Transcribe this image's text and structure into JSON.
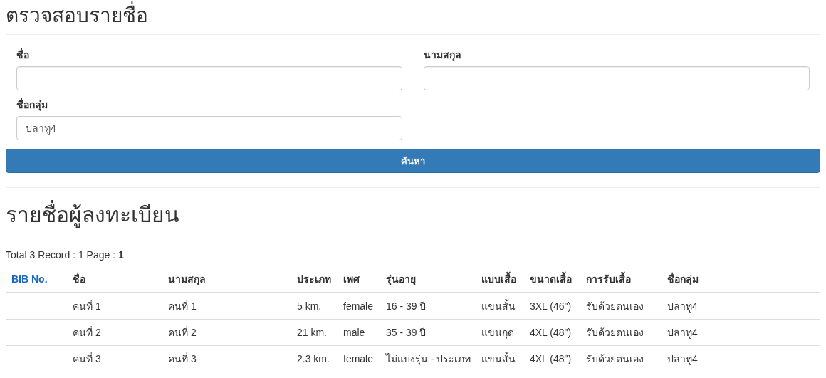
{
  "title": "ตรวจสอบรายชื่อ",
  "search_form": {
    "fields": [
      {
        "label": "ชื่อ"
      },
      {
        "label": "นามสกุล"
      },
      {
        "label": "ชื่อกลุ่ม",
        "value": "ปลาทู4"
      }
    ],
    "submit_button": "ค้นหา"
  },
  "results_title": "รายชื่อผู้ลงทะเบียน",
  "summary": "Total 3 Record : 1 Page : **1**",
  "table": {
    "columns": [
      {
        "label": "BIB No.",
        "kind": "link"
      },
      {
        "label": "ชื่อ",
        "kind": "text"
      },
      {
        "label": "นามสกุล",
        "kind": "text"
      },
      {
        "label": "ประเภท",
        "kind": "text"
      },
      {
        "label": "เพศ",
        "kind": "text"
      },
      {
        "label": "รุ่นอายุ",
        "kind": "text"
      },
      {
        "label": "แบบเสื้อ",
        "kind": "text"
      },
      {
        "label": "ขนาดเสื้อ",
        "kind": "text"
      },
      {
        "label": "การรับเสื้อ",
        "kind": "text"
      },
      {
        "label": "ชื่อกลุ่ม",
        "kind": "text"
      }
    ],
    "rows": [
      [
        null,
        "คนที่ 1",
        "คนที่ 1",
        "5 km.",
        "female",
        "16 - 39 ปี",
        "แขนสั้น",
        "3XL (46\")",
        "รับด้วยตนเอง",
        "ปลาทู4"
      ],
      [
        null,
        "คนที่ 2",
        "คนที่ 2",
        "21 km.",
        "male",
        "35 - 39 ปี",
        "แขนกุด",
        "4XL (48\")",
        "รับด้วยตนเอง",
        "ปลาทู4"
      ],
      [
        null,
        "คนที่ 3",
        "คนที่ 3",
        "2.3 km.",
        "female",
        "ไม่แบ่งรุ่น - ประเภท",
        "แขนสั้น",
        "4XL (48\")",
        "รับด้วยตนเอง",
        "ปลาทู4"
      ]
    ]
  }
}
